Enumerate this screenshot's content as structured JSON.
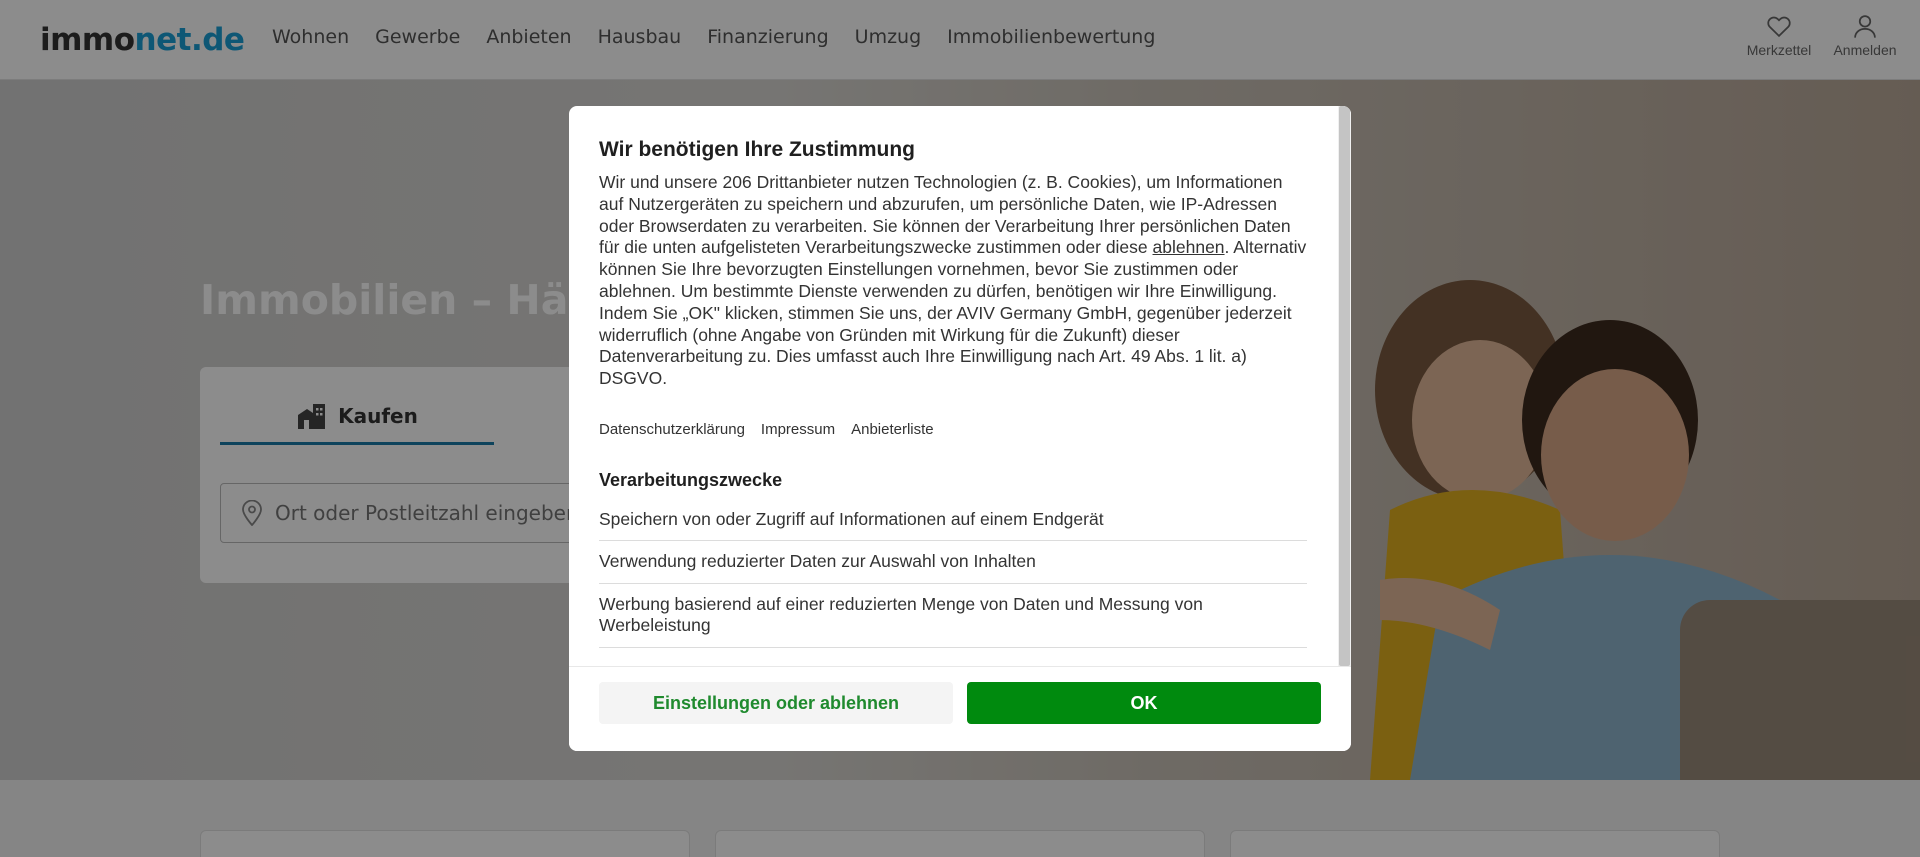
{
  "header": {
    "logo_part1": "immo",
    "logo_part2": "net.de",
    "nav": [
      "Wohnen",
      "Gewerbe",
      "Anbieten",
      "Hausbau",
      "Finanzierung",
      "Umzug",
      "Immobilienbewertung"
    ],
    "watchlist_label": "Merkzettel",
    "login_label": "Anmelden"
  },
  "hero": {
    "title": "Immobilien – Häuse",
    "tab_buy_label": "Kaufen",
    "location_placeholder": "Ort oder Postleitzahl eingeben"
  },
  "consent": {
    "title": "Wir benötigen Ihre Zustimmung",
    "body_before_link": "Wir und unsere 206 Drittanbieter nutzen Technologien (z. B. Cookies), um Informationen auf Nutzergeräten zu speichern und abzurufen, um persönliche Daten, wie IP-Adressen oder Browserdaten zu verarbeiten. Sie können der Verarbeitung Ihrer persönlichen Daten für die unten aufgelisteten Verarbeitungszwecke zustimmen oder diese ",
    "body_link": "ablehnen",
    "body_after_link": ". Alternativ können Sie Ihre bevorzugten Einstellungen vornehmen, bevor Sie zustimmen oder ablehnen. Um bestimmte Dienste verwenden zu dürfen, benötigen wir Ihre Einwilligung. Indem Sie „OK\" klicken, stimmen Sie uns, der AVIV Germany GmbH, gegenüber jederzeit widerruflich (ohne Angabe von Gründen mit Wirkung für die Zukunft) dieser Datenverarbeitung zu. Dies umfasst auch Ihre Einwilligung nach Art. 49 Abs. 1 lit. a) DSGVO.",
    "links": [
      "Datenschutzerklärung",
      "Impressum",
      "Anbieterliste"
    ],
    "purposes_title": "Verarbeitungszwecke",
    "purposes": [
      "Speichern von oder Zugriff auf Informationen auf einem Endgerät",
      "Verwendung reduzierter Daten zur Auswahl von Inhalten",
      "Werbung basierend auf einer reduzierten Menge von Daten und Messung von Werbeleistung"
    ],
    "decline_label": "Einstellungen oder ablehnen",
    "ok_label": "OK"
  },
  "colors": {
    "brand_blue": "#1a9fd6",
    "ok_green": "#008a0e",
    "decline_text_green": "#1f8a2e"
  }
}
